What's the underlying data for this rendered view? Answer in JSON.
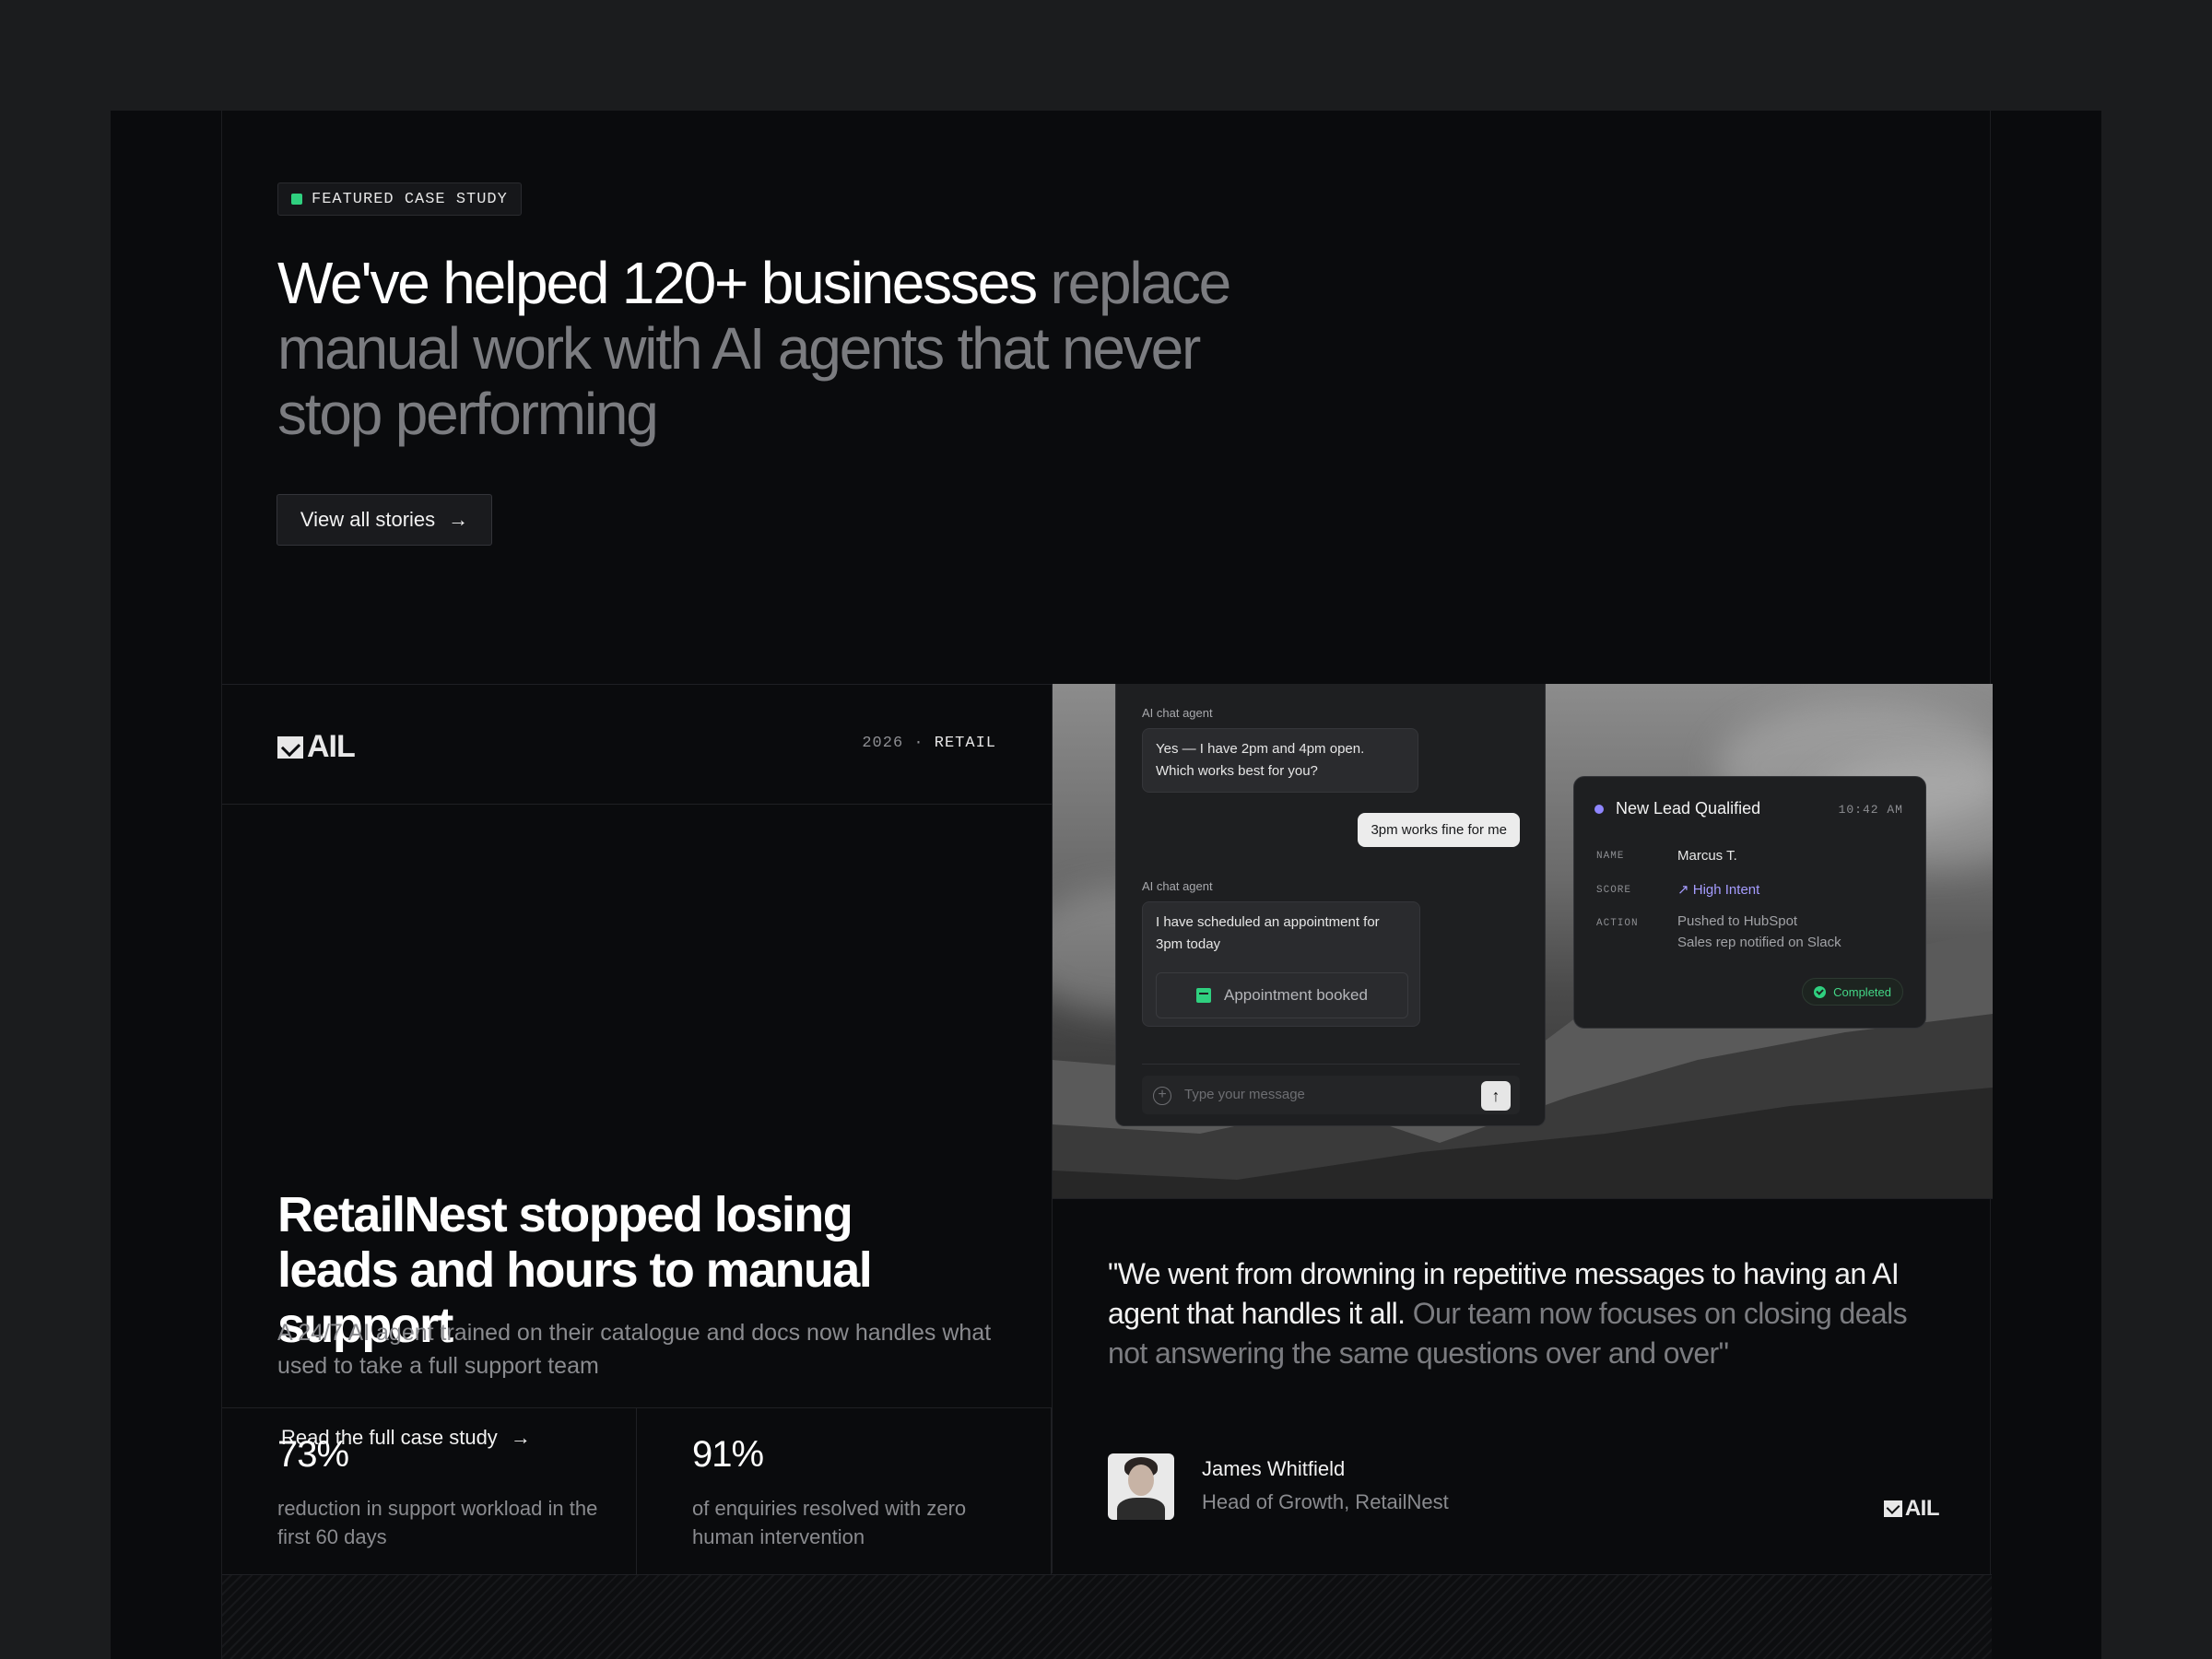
{
  "hero": {
    "badge": "FEATURED CASE STUDY",
    "headline_strong": "We've helped 120+ businesses",
    "headline_muted": "replace manual work with AI agents that never stop performing",
    "button_label": "View all stories"
  },
  "case_study": {
    "company": "AIL",
    "year": "2026",
    "separator": "·",
    "category": "RETAIL",
    "title": "RetailNest stopped losing leads and hours to manual support",
    "description": "A 24/7 AI agent trained on their catalogue and docs now handles what used to take a full support team",
    "link_label": "Read the full case study"
  },
  "stats": [
    {
      "value": "73%",
      "label": "reduction in support workload in the first 60 days"
    },
    {
      "value": "91%",
      "label": "of enquiries resolved with zero human intervention"
    }
  ],
  "chat": {
    "agent_label": "AI chat agent",
    "message_1": "Yes — I have 2pm and 4pm open. Which works best for you?",
    "user_reply": "3pm works fine for me",
    "message_2": "I have scheduled an appointment for 3pm today",
    "appointment_label": "Appointment booked",
    "input_placeholder": "Type your message"
  },
  "lead_card": {
    "title": "New Lead Qualified",
    "time": "10:42 AM",
    "name_key": "NAME",
    "name_value": "Marcus T.",
    "score_key": "SCORE",
    "score_value": "High Intent",
    "action_key": "ACTION",
    "action_line_1": "Pushed to HubSpot",
    "action_line_2": "Sales rep notified on Slack",
    "status": "Completed"
  },
  "testimonial": {
    "quote_strong": "\"We went from drowning in repetitive messages to having an AI agent that handles it all.",
    "quote_muted": "Our team now focuses on closing deals not answering the same questions over and over\"",
    "person_name": "James Whitfield",
    "person_role": "Head of Growth, RetailNest",
    "company": "AIL"
  },
  "colors": {
    "background": "#1b1c1e",
    "panel": "#0a0b0d",
    "accent_green": "#2fd07f",
    "accent_purple": "#8f86ff"
  },
  "icons": {
    "badge": "green-square-icon",
    "button_arrow": "arrow-right-icon",
    "appointment": "calendar-check-icon",
    "input_add": "plus-circle-icon",
    "send": "arrow-up-icon",
    "score": "trending-up-icon",
    "status": "check-circle-icon"
  }
}
